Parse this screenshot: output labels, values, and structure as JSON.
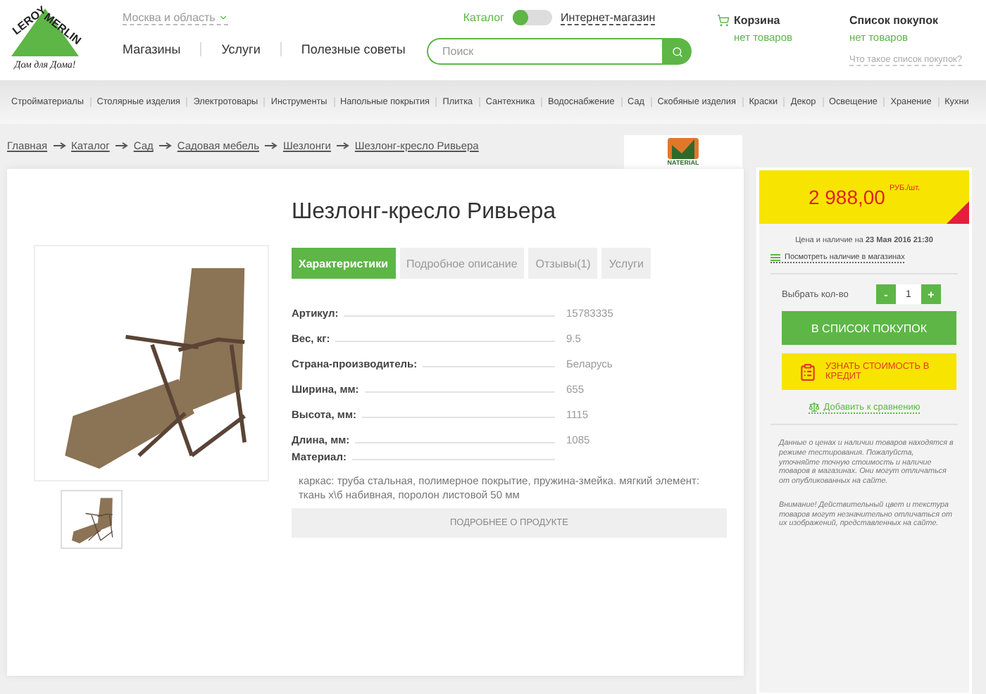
{
  "logo": {
    "brand_top": "LEROY",
    "brand_bottom": "MERLIN",
    "tagline": "Дом для Дома!"
  },
  "header": {
    "region": "Москва и область",
    "nav": [
      "Магазины",
      "Услуги",
      "Полезные советы"
    ],
    "switch": {
      "left_label": "Каталог",
      "right_label": "Интернет-магазин",
      "on": false
    },
    "search": {
      "placeholder": "Поиск"
    },
    "cart": {
      "title": "Корзина",
      "status": "нет товаров"
    },
    "shopping_list": {
      "title": "Список покупок",
      "status": "нет товаров",
      "help_link": "Что такое список покупок?"
    }
  },
  "categories": [
    "Стройматериалы",
    "Столярные изделия",
    "Электротовары",
    "Инструменты",
    "Напольные покрытия",
    "Плитка",
    "Сантехника",
    "Водоснабжение",
    "Сад",
    "Скобяные изделия",
    "Краски",
    "Декор",
    "Освещение",
    "Хранение",
    "Кухни"
  ],
  "breadcrumbs": [
    "Главная",
    "Каталог",
    "Сад",
    "Садовая мебель",
    "Шезлонги",
    "Шезлонг-кресло Ривьера"
  ],
  "brand_badge": "NATERIAL",
  "product": {
    "title": "Шезлонг-кресло Ривьера",
    "tabs": [
      {
        "label": "Характеристики",
        "selected": true
      },
      {
        "label": "Подробное описание",
        "selected": false
      },
      {
        "label": "Отзывы(1)",
        "selected": false
      },
      {
        "label": "Услуги",
        "selected": false
      }
    ],
    "specs": [
      {
        "label": "Артикул:",
        "value": "15783335"
      },
      {
        "label": "Вес, кг:",
        "value": "9.5"
      },
      {
        "label": "Страна-производитель:",
        "value": "Беларусь"
      },
      {
        "label": "Ширина, мм:",
        "value": "655"
      },
      {
        "label": "Высота, мм:",
        "value": "1115"
      },
      {
        "label": "Длина, мм:",
        "value": "1085"
      },
      {
        "label": "Материал:"
      }
    ],
    "material_text": "каркас: труба стальная, полимерное покрытие, пружина-змейка. мягкий элемент: ткань х\\б набивная, поролон листовой 50 мм",
    "more_button": "ПОДРОБНЕЕ О ПРОДУКТЕ"
  },
  "buy_panel": {
    "price": "2 988,00",
    "unit": "РУБ./шт.",
    "updated_prefix": "Цена и наличие на",
    "updated_date": "23 Мая 2016 21:30",
    "stock_link": "Посмотреть наличие в магазинах",
    "quantity": {
      "label": "Выбрать кол-во",
      "minus": "-",
      "value": "1",
      "plus": "+"
    },
    "add_button": "В СПИСОК ПОКУПОК",
    "credit_button": "УЗНАТЬ СТОИМОСТЬ В КРЕДИТ",
    "compare_link": "Добавить к сравнению",
    "notes": [
      "Данные о ценах и наличии товаров находятся в режиме тестирования. Пожалуйста, уточняйте точную стоимость и наличие товаров в магазинах. Они могут отличаться от опубликованных на сайте.",
      "Внимание! Действительный цвет и текстура товаров могут незначительно отличаться от их изображений, представленных на сайте."
    ]
  }
}
